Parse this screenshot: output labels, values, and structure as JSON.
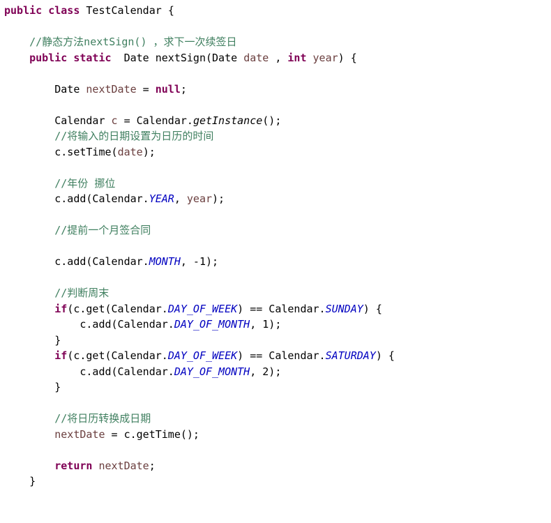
{
  "l1": {
    "kw1": "public",
    "kw2": "class",
    "name": "TestCalendar",
    "br": "{"
  },
  "l2": {
    "c": "//静态方法nextSign() ，求下一次续签日"
  },
  "l3": {
    "kw1": "public",
    "kw2": "static",
    "type": "Date",
    "name": "nextSign(",
    "ptype1": "Date",
    "p1": "date",
    "sep": " , ",
    "kw3": "int",
    "p2": "year",
    "end": ") {"
  },
  "l4": {
    "type": "Date",
    "var": "nextDate",
    "eq": " = ",
    "lit": "null",
    "end": ";"
  },
  "l5": {
    "type": "Calendar",
    "var": "c",
    "eq": " = Calendar.",
    "m": "getInstance",
    "end": "();"
  },
  "l6": {
    "c": "//将输入的日期设置为日历的时间"
  },
  "l7": {
    "a": "c.setTime(",
    "p": "date",
    "end": ");"
  },
  "l8": {
    "c": "//年份 挪位"
  },
  "l9": {
    "a": "c.add(Calendar.",
    "f": "YEAR",
    "b": ", ",
    "p": "year",
    "end": ");"
  },
  "l10": {
    "c": "//提前一个月签合同"
  },
  "l11": {
    "a": "c.add(Calendar.",
    "f": "MONTH",
    "b": ", -1);"
  },
  "l12": {
    "c": "//判断周末"
  },
  "l13": {
    "kw": "if",
    "a": "(c.get(Calendar.",
    "f1": "DAY_OF_WEEK",
    "b": ") == Calendar.",
    "f2": "SUNDAY",
    "c": ") {"
  },
  "l14": {
    "a": "c.add(Calendar.",
    "f": "DAY_OF_MONTH",
    "b": ", 1);"
  },
  "l15": {
    "a": "}"
  },
  "l16": {
    "kw": "if",
    "a": "(c.get(Calendar.",
    "f1": "DAY_OF_WEEK",
    "b": ") == Calendar.",
    "f2": "SATURDAY",
    "c": ") {"
  },
  "l17": {
    "a": "c.add(Calendar.",
    "f": "DAY_OF_MONTH",
    "b": ", 2);"
  },
  "l18": {
    "a": "}"
  },
  "l19": {
    "c": "//将日历转换成日期"
  },
  "l20": {
    "a": "nextDate",
    "b": " = c.getTime();"
  },
  "l21": {
    "kw": "return",
    "a": " ",
    "v": "nextDate",
    "end": ";"
  },
  "l22": {
    "a": "}"
  }
}
